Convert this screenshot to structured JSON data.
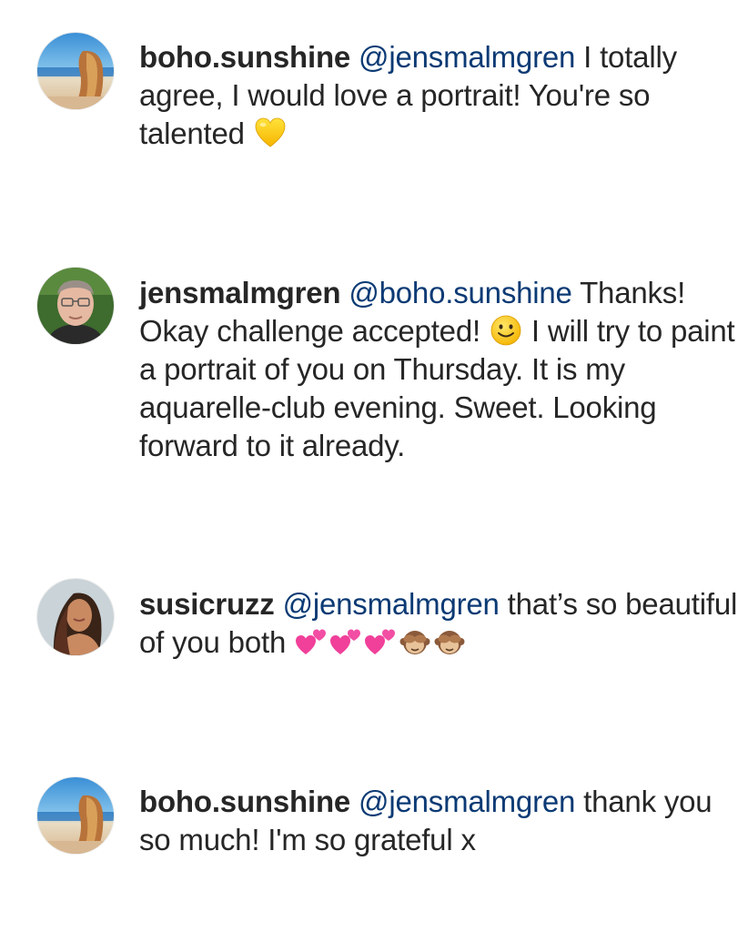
{
  "comments": [
    {
      "username": "boho.sunshine",
      "mention": "@jensmalmgren",
      "text_before_emoji": " I totally agree, I would love a portrait! You're so talented ",
      "emoji": "yellow-heart",
      "text_after_emoji": ""
    },
    {
      "username": "jensmalmgren",
      "mention": "@boho.sunshine",
      "text_before_emoji": " Thanks! Okay challenge accepted! ",
      "emoji": "slightly-smiling-face",
      "text_after_emoji": " I will try to paint a portrait of you on Thursday. It is my aquarelle-club evening. Sweet. Looking forward to it already."
    },
    {
      "username": "susicruzz",
      "mention": "@jensmalmgren",
      "text_before_emoji": " that’s so beautiful of you both ",
      "emoji": "two-hearts x3, see-no-evil-monkey x2",
      "text_after_emoji": ""
    },
    {
      "username": "boho.sunshine",
      "mention": "@jensmalmgren",
      "text_before_emoji": " thank you so much! I'm so grateful x",
      "emoji": "",
      "text_after_emoji": ""
    }
  ],
  "colors": {
    "username": "#262626",
    "mention": "#0b3a74",
    "text": "#262626",
    "background": "#ffffff"
  }
}
